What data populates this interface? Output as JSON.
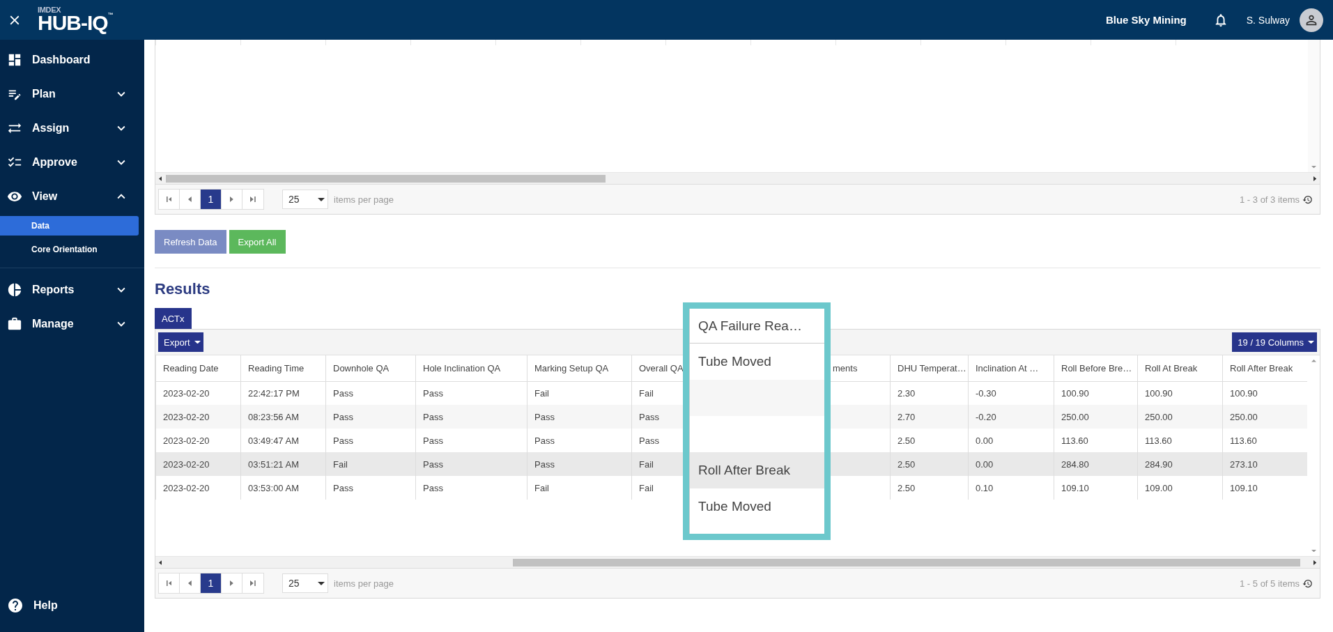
{
  "logo": {
    "brand": "IMDEX",
    "product": "HUB-IQ",
    "mark": "™"
  },
  "header": {
    "org": "Blue Sky Mining",
    "user": "S. Sulway"
  },
  "sidebar": {
    "items": [
      {
        "label": "Dashboard",
        "kind": "link"
      },
      {
        "label": "Plan",
        "kind": "group",
        "expanded": false
      },
      {
        "label": "Assign",
        "kind": "group",
        "expanded": false
      },
      {
        "label": "Approve",
        "kind": "group",
        "expanded": false
      },
      {
        "label": "View",
        "kind": "group",
        "expanded": true,
        "children": [
          {
            "label": "Data",
            "selected": true
          },
          {
            "label": "Core Orientation",
            "selected": false
          }
        ]
      },
      {
        "label": "Reports",
        "kind": "group",
        "expanded": false
      },
      {
        "label": "Manage",
        "kind": "group",
        "expanded": false
      }
    ],
    "help": "Help"
  },
  "top_grid": {
    "pager": {
      "pages": [
        {
          "label": "1",
          "selected": true
        }
      ],
      "per_page": "25",
      "per_page_label": "items per page",
      "summary": "1 - 3 of 3 items"
    }
  },
  "actions": [
    "Refresh Data",
    "Export All"
  ],
  "results": {
    "title": "Results",
    "tabs": [
      {
        "label": "ACTx",
        "selected": true
      }
    ],
    "export": "Export",
    "columns_button": "19 / 19 Columns",
    "columns": [
      "Reading Date",
      "Reading Time",
      "Downhole QA",
      "Hole Inclination QA",
      "Marking Setup QA",
      "Overall QA",
      null,
      "ments",
      "DHU Temperat…",
      "Inclination At …",
      "Roll Before Bre…",
      "Roll At Break",
      "Roll After Break"
    ],
    "rows": [
      {
        "hovered": false,
        "cells": [
          "2023-02-20",
          "22:42:17 PM",
          "Pass",
          "Pass",
          "Fail",
          "Fail",
          null,
          null,
          "2.30",
          "-0.30",
          "100.90",
          "100.90",
          "100.90"
        ]
      },
      {
        "hovered": false,
        "cells": [
          "2023-02-20",
          "08:23:56 AM",
          "Pass",
          "Pass",
          "Pass",
          "Pass",
          null,
          null,
          "2.70",
          "-0.20",
          "250.00",
          "250.00",
          "250.00"
        ]
      },
      {
        "hovered": false,
        "cells": [
          "2023-02-20",
          "03:49:47 AM",
          "Pass",
          "Pass",
          "Pass",
          "Pass",
          null,
          null,
          "2.50",
          "0.00",
          "113.60",
          "113.60",
          "113.60"
        ]
      },
      {
        "hovered": true,
        "cells": [
          "2023-02-20",
          "03:51:21 AM",
          "Fail",
          "Pass",
          "Pass",
          "Fail",
          null,
          null,
          "2.50",
          "0.00",
          "284.80",
          "284.90",
          "273.10"
        ]
      },
      {
        "hovered": false,
        "cells": [
          "2023-02-20",
          "03:53:00 AM",
          "Pass",
          "Pass",
          "Fail",
          "Fail",
          null,
          null,
          "2.50",
          "0.10",
          "109.10",
          "109.00",
          "109.10"
        ]
      }
    ],
    "pager": {
      "pages": [
        {
          "label": "1",
          "selected": true
        }
      ],
      "per_page": "25",
      "per_page_label": "items per page",
      "summary": "1 - 5 of 5 items"
    },
    "magnifier": {
      "header": "QA Failure Rea…",
      "cells": [
        "Tube Moved",
        null,
        null,
        "Roll After Break",
        "Tube Moved"
      ]
    }
  }
}
